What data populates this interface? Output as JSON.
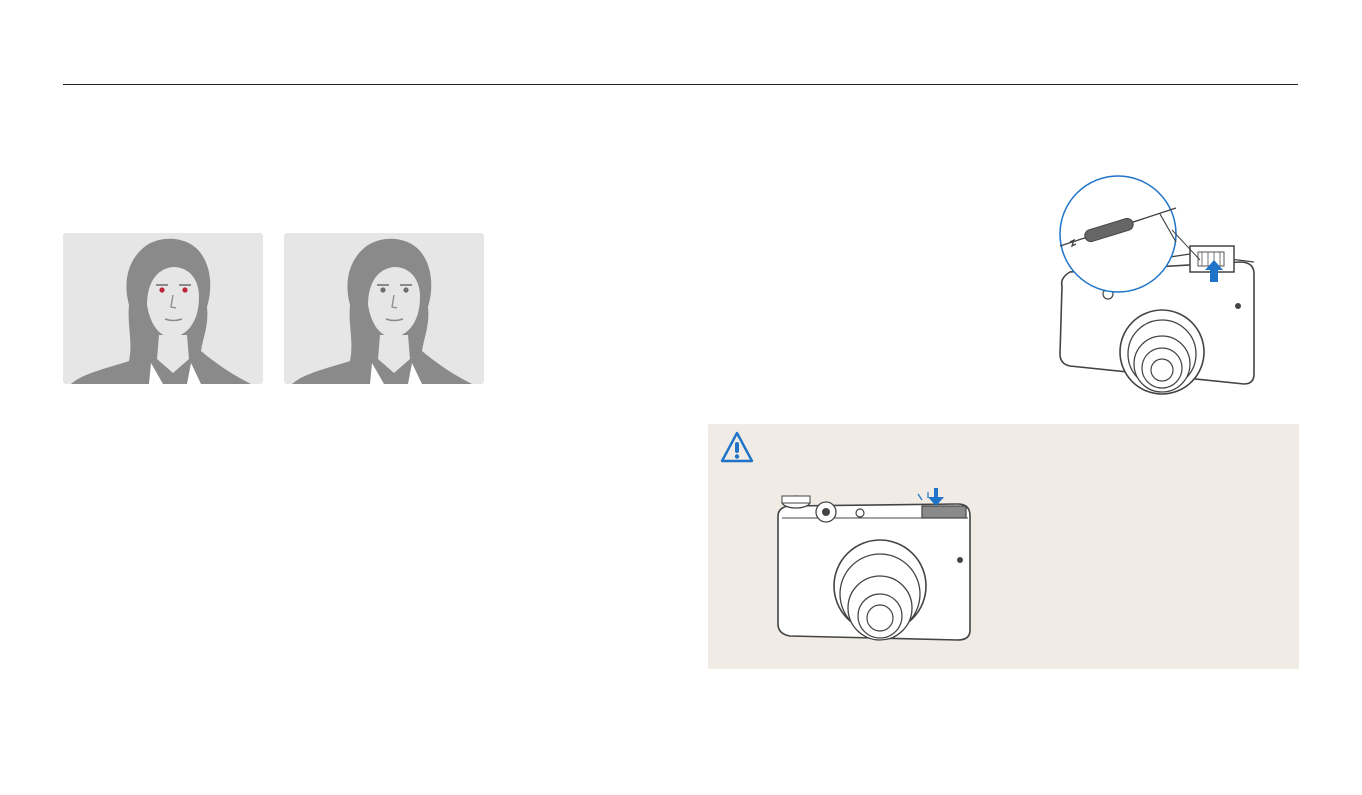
{
  "colors": {
    "rule": "#222222",
    "panel_bg": "#e6e6e6",
    "silhouette": "#8a8a8a",
    "red_eye": "#c0263a",
    "callout_blue": "#1f73c8",
    "warning_bg": "#f0ebe4",
    "warning_icon": "#1f73c8"
  },
  "illustrations": {
    "red_eye_example": "face-with-red-eyes",
    "corrected_example": "face-without-red-eyes",
    "flash_popup": "camera-flash-popup-illustration",
    "flash_push_down": "camera-flash-push-down-illustration"
  },
  "warning": {
    "icon": "warning-icon"
  }
}
